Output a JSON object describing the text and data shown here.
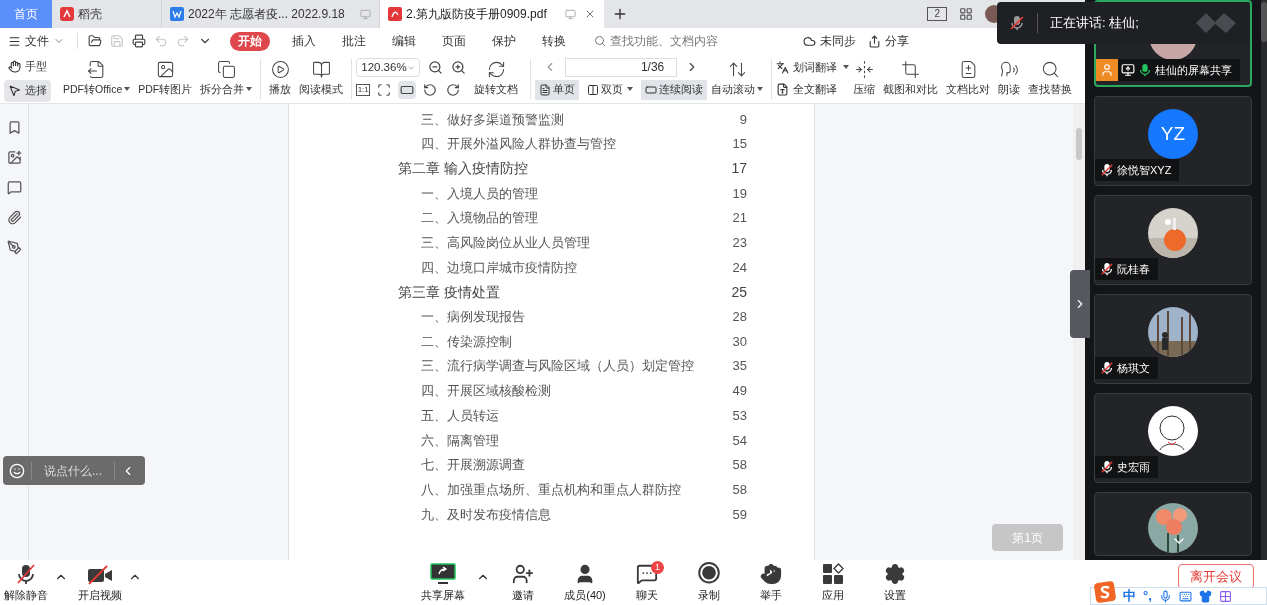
{
  "tabs": [
    {
      "label": "首页",
      "kind": "home",
      "selected": false
    },
    {
      "label": "稻壳",
      "kind": "app",
      "selected": false
    },
    {
      "label": "2022年 志愿者疫... 2022.9.18",
      "kind": "doc",
      "selected": false
    },
    {
      "label": "2.第九版防疫手册0909.pdf",
      "kind": "pdf",
      "selected": true
    }
  ],
  "tab_bar_badge": "2",
  "menu": {
    "file": "文件",
    "quick_actions": [
      {
        "kind": "open",
        "disabled": false
      },
      {
        "kind": "save",
        "disabled": true
      },
      {
        "kind": "print",
        "disabled": false
      },
      {
        "kind": "undo",
        "disabled": true
      },
      {
        "kind": "redo",
        "disabled": true
      },
      {
        "kind": "more",
        "disabled": false
      }
    ],
    "tabs": [
      {
        "label": "开始",
        "selected": true
      },
      {
        "label": "插入",
        "selected": false
      },
      {
        "label": "批注",
        "selected": false
      },
      {
        "label": "编辑",
        "selected": false
      },
      {
        "label": "页面",
        "selected": false
      },
      {
        "label": "保护",
        "selected": false
      },
      {
        "label": "转换",
        "selected": false
      }
    ],
    "search_placeholder": "查找功能、文档内容",
    "sync": "未同步",
    "share": "分享"
  },
  "toolbar": {
    "pointer_tools": [
      {
        "label": "手型",
        "kind": "hand",
        "selected": false
      },
      {
        "label": "选择",
        "kind": "select",
        "selected": true
      }
    ],
    "convert": [
      {
        "label": "PDF转Office",
        "kind": "pdf-office",
        "dropdown": true
      },
      {
        "label": "PDF转图片",
        "kind": "pdf-image",
        "dropdown": false
      },
      {
        "label": "拆分合并",
        "kind": "split",
        "dropdown": true
      }
    ],
    "view": [
      {
        "label": "播放",
        "kind": "play",
        "dropdown": false
      },
      {
        "label": "阅读模式",
        "kind": "book",
        "dropdown": false
      }
    ],
    "zoom": "120.36%",
    "fit_tools": [
      {
        "kind": "actual",
        "label": "1:1",
        "selected": false
      },
      {
        "kind": "fit-page",
        "selected": false
      },
      {
        "kind": "fit-width",
        "selected": true
      },
      {
        "kind": "rotate-left",
        "selected": false
      },
      {
        "kind": "rotate-right",
        "selected": false
      }
    ],
    "rotate": "旋转文档",
    "page": "1/36",
    "page_views": [
      {
        "label": "单页",
        "kind": "single",
        "selected": true,
        "dropdown": false
      },
      {
        "label": "双页",
        "kind": "double",
        "selected": false,
        "dropdown": true
      },
      {
        "label": "连续阅读",
        "kind": "continuous",
        "selected": true,
        "dropdown": false
      }
    ],
    "auto_scroll": {
      "label": "自动滚动",
      "dropdown": true
    },
    "translate": [
      {
        "label": "划词翻译",
        "kind": "word",
        "dropdown": true
      },
      {
        "label": "全文翻译",
        "kind": "full",
        "dropdown": false
      }
    ],
    "tools": [
      {
        "label": "压缩",
        "kind": "compress"
      },
      {
        "label": "截图和对比",
        "kind": "screenshot"
      },
      {
        "label": "文档比对",
        "kind": "compare"
      },
      {
        "label": "朗读",
        "kind": "read-aloud"
      },
      {
        "label": "查找替换",
        "kind": "find"
      }
    ]
  },
  "toc": [
    {
      "kind": "section",
      "label": "三、做好多渠道预警监测",
      "page": "9"
    },
    {
      "kind": "section",
      "label": "四、开展外溢风险人群协查与管控",
      "page": "15"
    },
    {
      "kind": "chapter",
      "label": "第二章 输入疫情防控",
      "page": "17"
    },
    {
      "kind": "section",
      "label": "一、入境人员的管理",
      "page": "19"
    },
    {
      "kind": "section",
      "label": "二、入境物品的管理",
      "page": "21"
    },
    {
      "kind": "section",
      "label": "三、高风险岗位从业人员管理",
      "page": "23"
    },
    {
      "kind": "section",
      "label": "四、边境口岸城市疫情防控",
      "page": "24"
    },
    {
      "kind": "chapter",
      "label": "第三章 疫情处置",
      "page": "25"
    },
    {
      "kind": "section",
      "label": "一、病例发现报告",
      "page": "28"
    },
    {
      "kind": "section",
      "label": "二、传染源控制",
      "page": "30"
    },
    {
      "kind": "section",
      "label": "三、流行病学调查与风险区域（人员）划定管控",
      "page": "35"
    },
    {
      "kind": "section",
      "label": "四、开展区域核酸检测",
      "page": "49"
    },
    {
      "kind": "section",
      "label": "五、人员转运",
      "page": "53"
    },
    {
      "kind": "section",
      "label": "六、隔离管理",
      "page": "54"
    },
    {
      "kind": "section",
      "label": "七、开展溯源调查",
      "page": "58"
    },
    {
      "kind": "section",
      "label": "八、加强重点场所、重点机构和重点人群防控",
      "page": "58"
    },
    {
      "kind": "section",
      "label": "九、及时发布疫情信息",
      "page": "59"
    }
  ],
  "chat_input": {
    "placeholder": "说点什么..."
  },
  "page_badge": "第1页",
  "speaker_notice": "正在讲话: 桂仙;",
  "participants": [
    {
      "name": "桂仙的屏幕共享",
      "kind": "share",
      "muted": false,
      "selected": true
    },
    {
      "name": "徐悦智XYZ",
      "kind": "initials",
      "initials": "YZ",
      "muted": true,
      "selected": false
    },
    {
      "name": "阮桂春",
      "kind": "picture",
      "muted": true,
      "selected": false
    },
    {
      "name": "杨琪文",
      "kind": "picture",
      "muted": true,
      "selected": false
    },
    {
      "name": "史宏雨",
      "kind": "picture",
      "muted": true,
      "selected": false
    },
    {
      "kind": "picture",
      "selected": false
    }
  ],
  "meeting_bar": [
    {
      "kind": "mute",
      "label": "解除静音",
      "menu": true
    },
    {
      "kind": "video",
      "label": "开启视频",
      "menu": true
    },
    {
      "kind": "share",
      "label": "共享屏幕",
      "menu": true
    },
    {
      "kind": "invite",
      "label": "邀请",
      "menu": false
    },
    {
      "kind": "members",
      "label": "成员(40)",
      "menu": false
    },
    {
      "kind": "chat",
      "label": "聊天",
      "menu": false,
      "badge": "1"
    },
    {
      "kind": "record",
      "label": "录制",
      "menu": false
    },
    {
      "kind": "hand",
      "label": "举手",
      "menu": false
    },
    {
      "kind": "apps",
      "label": "应用",
      "menu": false
    },
    {
      "kind": "settings",
      "label": "设置",
      "menu": false
    }
  ],
  "leave": "离开会议",
  "ime": {
    "lang": "中",
    "punct": "°,"
  }
}
